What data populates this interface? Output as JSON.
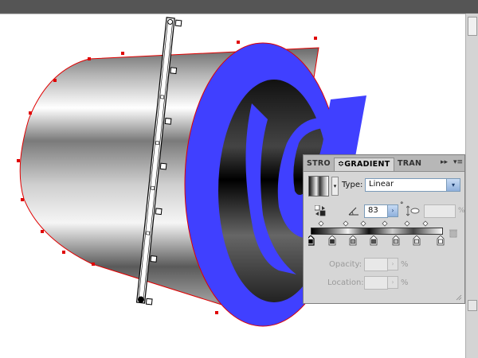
{
  "panel": {
    "tabs": [
      {
        "label": "STRO",
        "active": false
      },
      {
        "label": "GRADIENT",
        "active": true
      },
      {
        "label": "TRAN",
        "active": false
      }
    ],
    "type_label": "Type:",
    "type_value": "Linear",
    "angle_value": "83",
    "degree_symbol": "°",
    "aspect_value": "",
    "aspect_unit": "%",
    "opacity_label": "Opacity:",
    "opacity_unit": "%",
    "location_label": "Location:",
    "location_unit": "%",
    "color_stops_count": 7,
    "midpoints_count": 6
  },
  "colors": {
    "accent_blue": "#4040ff",
    "panel_bg": "#d6d6d6",
    "path_red": "#e00000"
  },
  "icons": [
    "gradient-swatch-icon",
    "reverse-gradient-icon",
    "angle-icon",
    "aspect-ratio-icon",
    "delete-stop-icon"
  ]
}
